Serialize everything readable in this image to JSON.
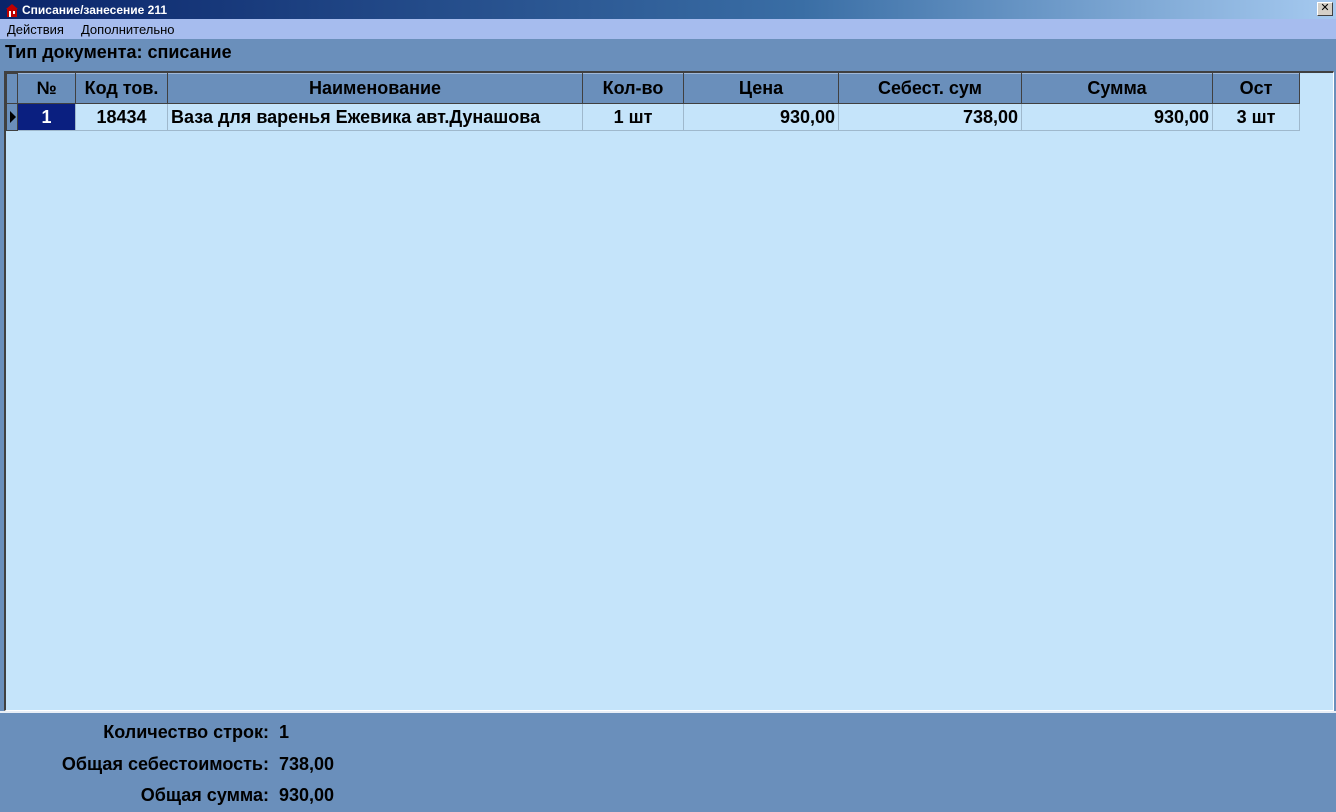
{
  "window": {
    "title": "Списание/занесение 211",
    "close_label": "✕"
  },
  "menu": {
    "items": [
      "Действия",
      "Дополнительно"
    ]
  },
  "doc_type": "Тип документа: списание",
  "grid": {
    "columns": [
      "№",
      "Код тов.",
      "Наименование",
      "Кол-во",
      "Цена",
      "Себест. сум",
      "Сумма",
      "Ост"
    ],
    "rows": [
      {
        "num": "1",
        "code": "18434",
        "name": "Ваза для варенья Ежевика авт.Дунашова",
        "qty": "1 шт",
        "price": "930,00",
        "cost_sum": "738,00",
        "sum": "930,00",
        "stock": "3 шт"
      }
    ]
  },
  "footer": {
    "rows_count_label": "Количество строк:",
    "rows_count_value": "1",
    "total_cost_label": "Общая себестоимость:",
    "total_cost_value": "738,00",
    "total_sum_label": "Общая сумма:",
    "total_sum_value": "930,00"
  },
  "colors": {
    "panel": "#6a8fbb",
    "grid_bg": "#c5e4fa",
    "selection": "#0a1f80",
    "menubar": "#a6bcee"
  }
}
